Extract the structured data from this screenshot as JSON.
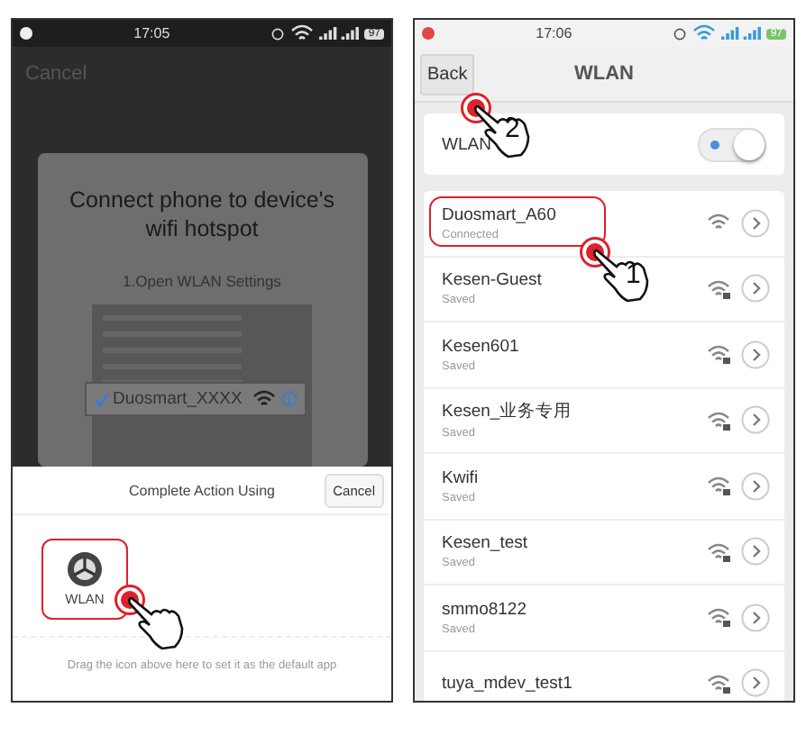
{
  "left_screen": {
    "status_bar": {
      "time": "17:05",
      "battery": "97"
    },
    "cancel": "Cancel",
    "dialog": {
      "title": "Connect phone to device's wifi hotspot",
      "step": "1.Open WLAN Settings",
      "preview_network": {
        "name": "Duosmart_XXXX",
        "checked": true
      }
    },
    "sheet": {
      "title": "Complete Action Using",
      "cancel": "Cancel",
      "apps": [
        {
          "label": "WLAN",
          "highlighted": true
        }
      ],
      "hint": "Drag the icon above here to set it as the default app"
    }
  },
  "right_screen": {
    "status_bar": {
      "time": "17:06",
      "battery": "97"
    },
    "back": "Back",
    "title": "WLAN",
    "callout": "2",
    "wlan_toggle": {
      "label": "WLAN",
      "on": true
    },
    "networks": [
      {
        "name": "Duosmart_A60",
        "status": "Connected",
        "secured": false,
        "highlighted": true,
        "callout": "1"
      },
      {
        "name": "Kesen-Guest",
        "status": "Saved",
        "secured": true,
        "highlighted": false
      },
      {
        "name": "Kesen601",
        "status": "Saved",
        "secured": true,
        "highlighted": false
      },
      {
        "name": "Kesen_业务专用",
        "status": "Saved",
        "secured": true,
        "highlighted": false
      },
      {
        "name": "Kwifi",
        "status": "Saved",
        "secured": true,
        "highlighted": false
      },
      {
        "name": "Kesen_test",
        "status": "Saved",
        "secured": true,
        "highlighted": false
      },
      {
        "name": "smmo8122",
        "status": "Saved",
        "secured": true,
        "highlighted": false
      },
      {
        "name": "tuya_mdev_test1",
        "secured": true,
        "highlighted": false
      }
    ]
  }
}
